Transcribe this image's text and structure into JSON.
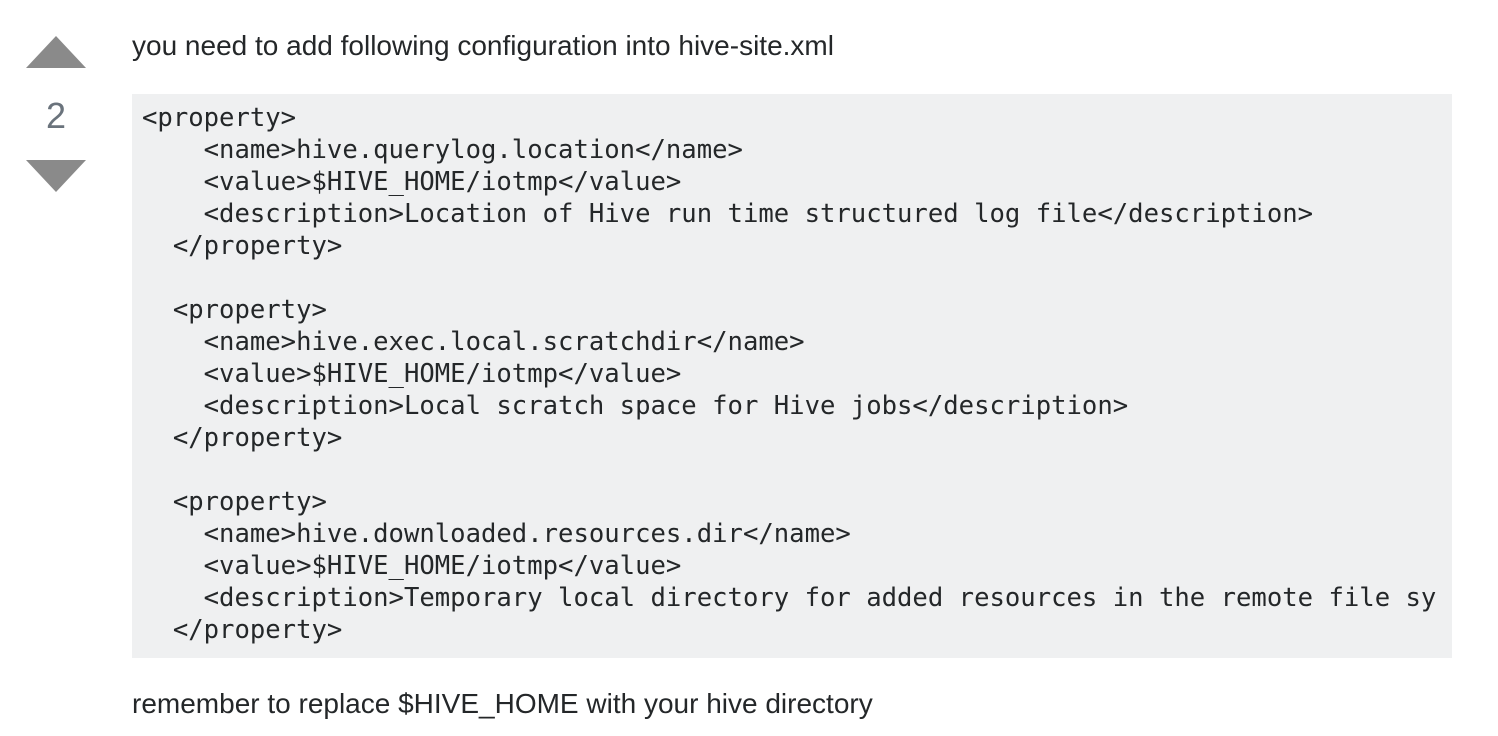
{
  "vote": {
    "count": "2"
  },
  "post": {
    "intro": "you need to add following configuration into hive-site.xml",
    "code": "<property>\n    <name>hive.querylog.location</name>\n    <value>$HIVE_HOME/iotmp</value>\n    <description>Location of Hive run time structured log file</description>\n  </property>\n\n  <property>\n    <name>hive.exec.local.scratchdir</name>\n    <value>$HIVE_HOME/iotmp</value>\n    <description>Local scratch space for Hive jobs</description>\n  </property>\n\n  <property>\n    <name>hive.downloaded.resources.dir</name>\n    <value>$HIVE_HOME/iotmp</value>\n    <description>Temporary local directory for added resources in the remote file sy\n  </property>",
    "outro": "remember to replace $HIVE_HOME with your hive directory"
  },
  "icons": {
    "up": "vote-up-triangle",
    "down": "vote-down-triangle"
  },
  "colors": {
    "vote_arrow": "#8a8a8a",
    "code_background": "#eff0f1",
    "text": "#242729"
  }
}
